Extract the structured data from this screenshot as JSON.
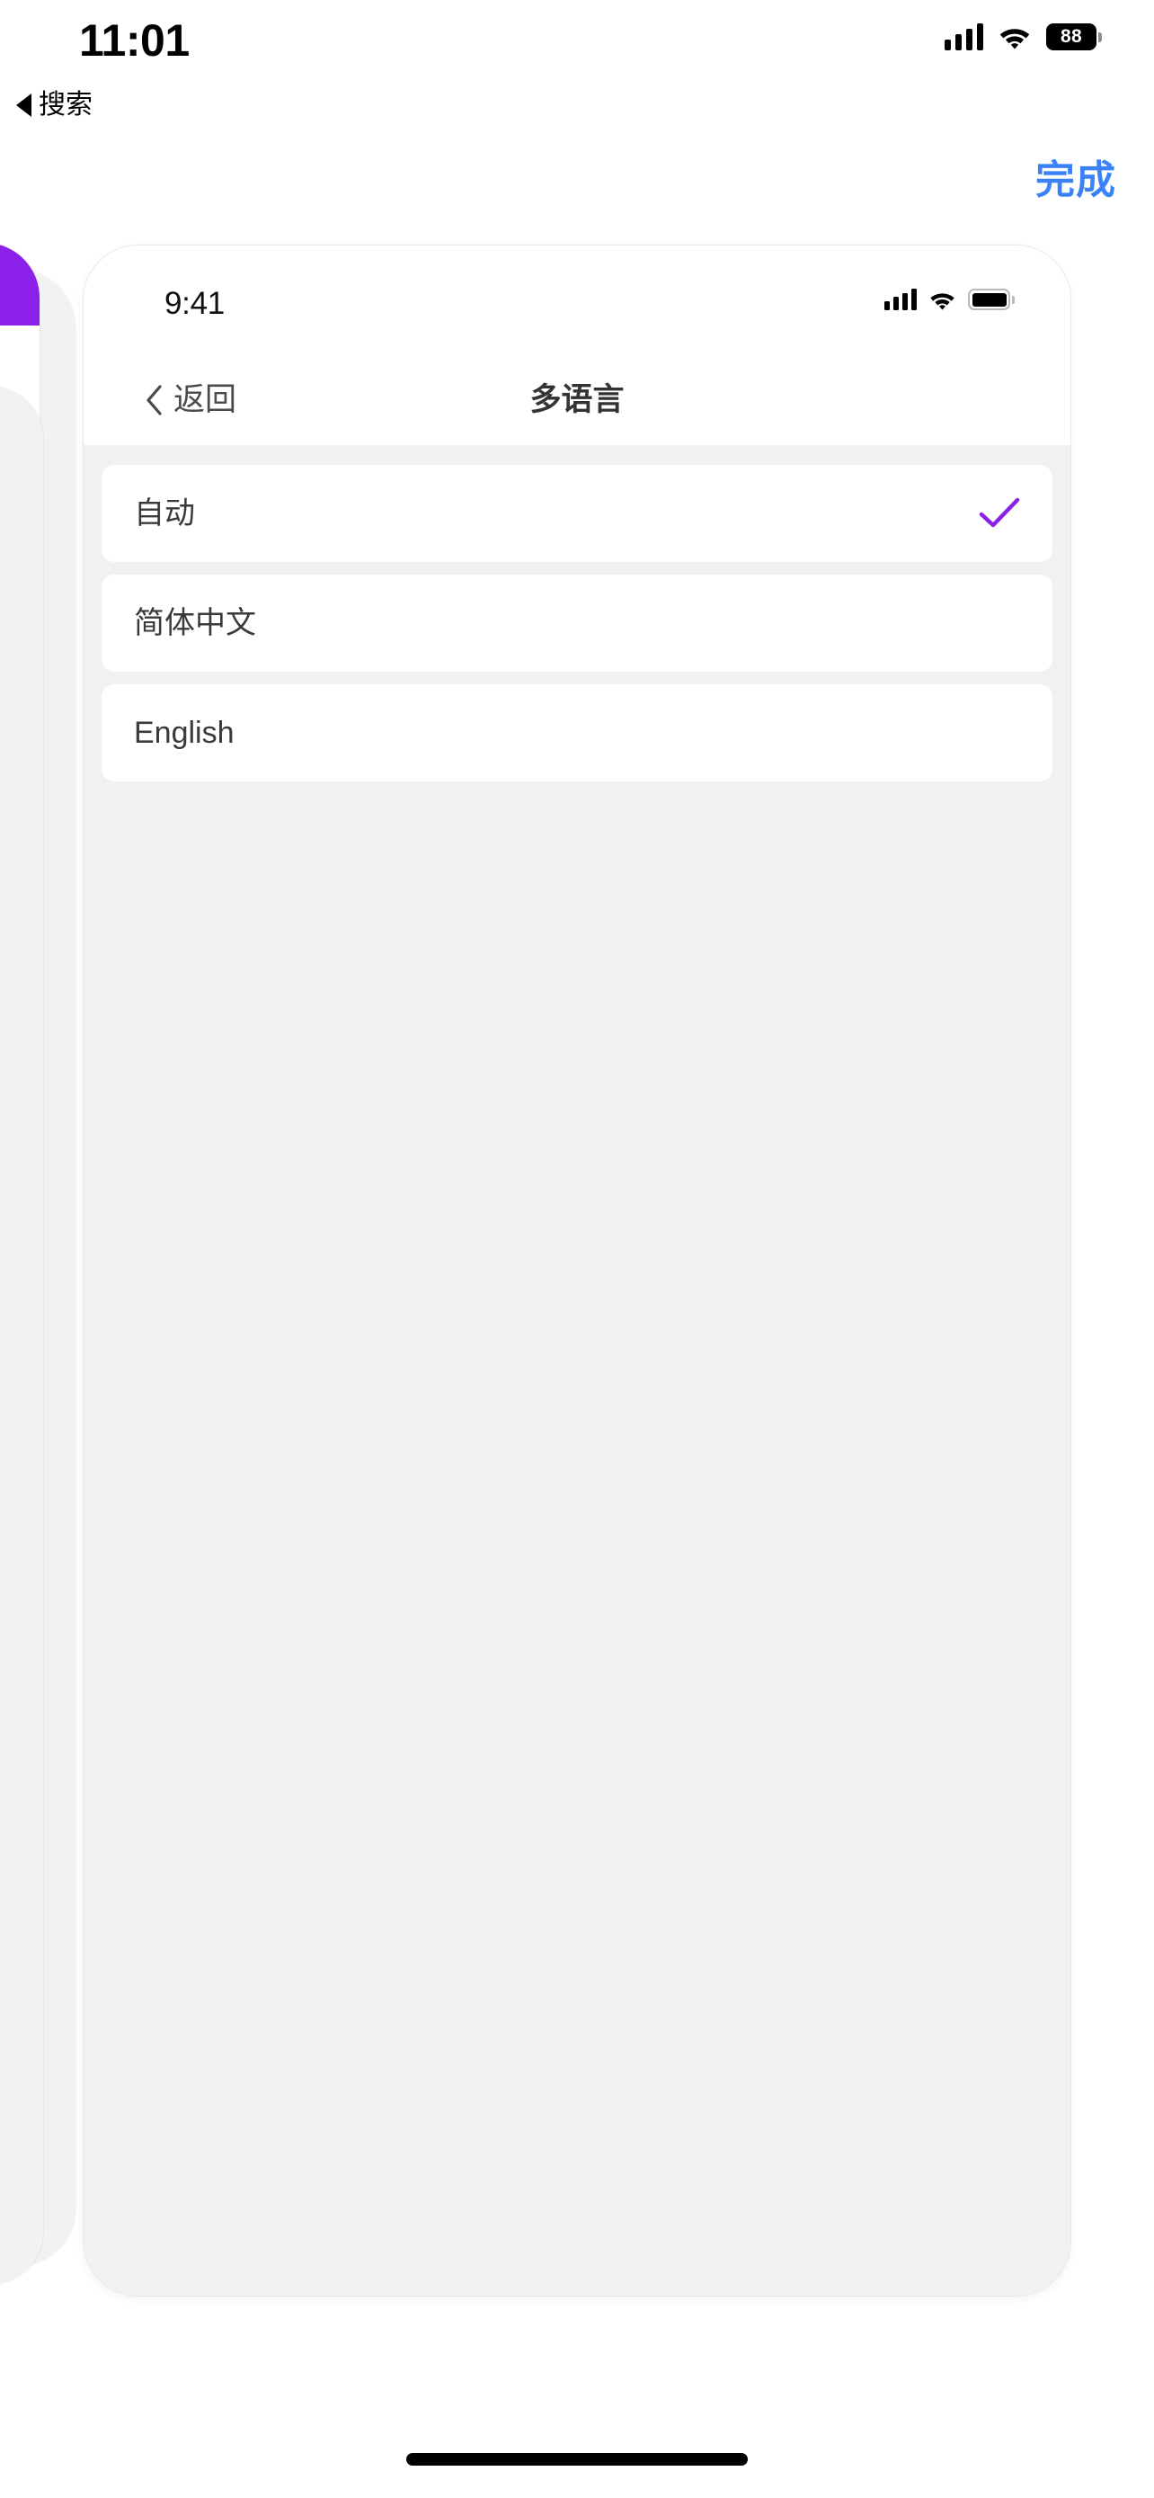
{
  "os_status": {
    "time": "11:01",
    "battery_percent": "88",
    "signal_icon": "signal-bars-icon",
    "wifi_icon": "wifi-icon",
    "battery_icon": "battery-icon"
  },
  "back_to_search": {
    "label": "搜索",
    "icon": "back-triangle-icon"
  },
  "toolbar": {
    "done_label": "完成",
    "accent_color": "#3b82f6"
  },
  "phone": {
    "status": {
      "time": "9:41",
      "signal_icon": "signal-bars-icon",
      "wifi_icon": "wifi-icon",
      "battery_icon": "battery-icon"
    },
    "nav": {
      "back_label": "返回",
      "back_icon": "chevron-left-icon",
      "title": "多语言"
    },
    "options": [
      {
        "label": "自动",
        "selected": true,
        "check_icon": "check-icon"
      },
      {
        "label": "简体中文",
        "selected": false,
        "check_icon": ""
      },
      {
        "label": "English",
        "selected": false,
        "check_icon": ""
      }
    ],
    "selected_color": "#8b20e8"
  },
  "card_stack": {
    "purple_accent": "#8b20e8"
  },
  "home_indicator": "home-indicator"
}
